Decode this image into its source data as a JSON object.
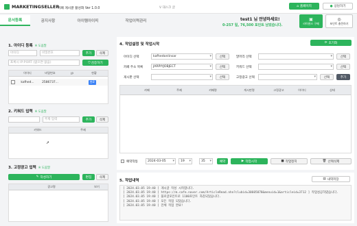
{
  "header": {
    "logo": "MARKETINGSELLER",
    "app_title": "카페 게시글 활성화 Ver 1.0.0",
    "notice_icon": "V 대스크 글",
    "home": "홈페이지",
    "consult": "상담하기"
  },
  "user": {
    "greeting": "test1 님 안녕하세요!",
    "points": "0-257 일, 76,500 포인트 남았습니다.",
    "license_btn": "라이센스 구매",
    "point_btn": "포인트 충전하기"
  },
  "tabs": [
    "문서등록",
    "공지사항",
    "아이템아이피",
    "작업이력관리"
  ],
  "sec1": {
    "title": "1. 아이디 등록",
    "sub": "※ 도움말",
    "id_ph": "아이디",
    "pw_ph": "비밀번호",
    "add": "추가",
    "del": "삭제",
    "proxy_ph": "프록시 IP:PORT (없으면 없음)",
    "check": "검증하기",
    "cols": [
      "",
      "아이디",
      "비밀번호",
      "IP",
      "현황"
    ],
    "rows": [
      {
        "id": "kafhed...",
        "pw": "2586737...",
        "ip": "",
        "status": "완료"
      }
    ]
  },
  "sec2": {
    "title": "2. 키워드 입력",
    "sub": "※ 도움말",
    "kw_ph": "주제 입력",
    "add": "추가",
    "del": "삭제",
    "cols": [
      "",
      "키워드",
      "주제"
    ]
  },
  "sec3": {
    "title": "3. 고정광고 입력",
    "sub": "※ 도움말",
    "write": "작성하기",
    "edit": "편집",
    "del": "삭제",
    "cols": [
      "",
      "광고명",
      "보기"
    ]
  },
  "sec4": {
    "title": "4. 작업설정 및 작업시작",
    "reset": "초기화",
    "id_label": "아이디 선택",
    "id_val": "kafhedonlinsar",
    "choose": "선택",
    "cafe_label": "카페 주소 목록",
    "cafe_val": "JARPIYJOBJECT",
    "board_label": "게시판 선택",
    "cat_label": "말머리 선택",
    "kw_label": "키워드 선택",
    "fixed_label": "고정광고 선택",
    "add": "추가",
    "cols": [
      "",
      "카페",
      "주제",
      "카페명",
      "게시판명",
      "고정광고",
      "아이디",
      "상태"
    ],
    "sched_label": "예약작동",
    "date": "2024-03-05",
    "hour": "19",
    "min": "35",
    "reserve": "예약",
    "start": "작업시작",
    "stop": "작업정지",
    "delsel": "선택삭제"
  },
  "sec5": {
    "title": "5. 작업내역",
    "detail": "내역저장",
    "logs": [
      "[ 2024.03.05 19:40 ] 게시글 작성 시작합니다.",
      "[ 2024.03.05 19:40 ] https://m.cafe.naver.com/ArticleRead.nhn?clubid=30605078&menuid=1&articleid=3712 ] 작업성공하였습니다.",
      "[ 2024.03.05 19:40 ] 블로글포인트로 1100포인트 차감되었습니다.",
      "[ 2024.03.05 19:40 ] 모든 작업 되었습니다.",
      "[ 2024.03.05 19:40 ] 전체 작업 완료!"
    ]
  }
}
